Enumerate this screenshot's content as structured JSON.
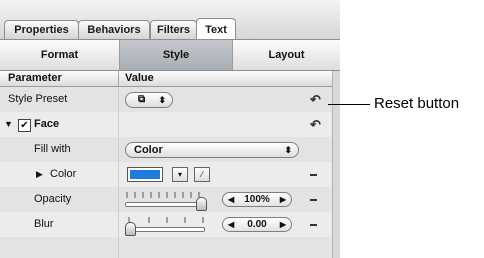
{
  "tabs": [
    "Properties",
    "Behaviors",
    "Filters",
    "Text"
  ],
  "segments": [
    "Format",
    "Style",
    "Layout"
  ],
  "columns": {
    "parameter": "Parameter",
    "value": "Value"
  },
  "rows": {
    "style_preset": {
      "label": "Style Preset"
    },
    "face": {
      "label": "Face",
      "checked": true
    },
    "fill_with": {
      "label": "Fill with",
      "value": "Color"
    },
    "color": {
      "label": "Color",
      "swatch": "#1e7bdd"
    },
    "opacity": {
      "label": "Opacity",
      "value": "100%",
      "level": 1.0
    },
    "blur": {
      "label": "Blur",
      "value": "0.00",
      "level": 0.0
    }
  },
  "callout": {
    "label": "Reset button"
  }
}
